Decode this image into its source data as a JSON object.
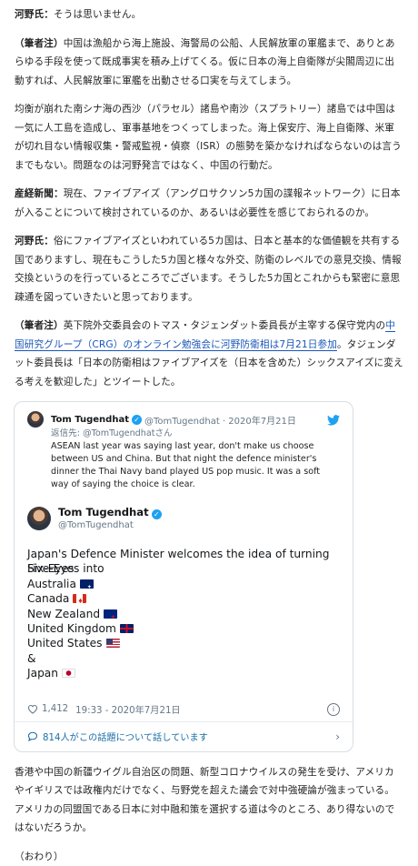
{
  "paragraphs": {
    "p1_speaker": "河野氏：",
    "p1_text": "そうは思いません。",
    "p2_speaker": "（筆者注）",
    "p2_text": "中国は漁船から海上施設、海警局の公船、人民解放軍の軍艦まで、ありとあらゆる手段を使って既成事実を積み上げてくる。仮に日本の海上自衛隊が尖閣周辺に出動すれば、人民解放軍に軍艦を出動させる口実を与えてしまう。",
    "p3_text": "均衡が崩れた南シナ海の西沙（パラセル）諸島や南沙（スプラトリー）諸島では中国は一気に人工島を造成し、軍事基地をつくってしまった。海上保安庁、海上自衛隊、米軍が切れ目ない情報収集・警戒監視・偵察（ISR）の態勢を築かなければならないのは言うまでもない。問題なのは河野発言ではなく、中国の行動だ。",
    "p4_speaker": "産経新聞：",
    "p4_text": "現在、ファイブアイズ（アングロサクソン5カ国の諜報ネットワーク）に日本が入ることについて検討されているのか、あるいは必要性を感じておられるのか。",
    "p5_speaker": "河野氏：",
    "p5_text": "俗にファイブアイズといわれている5カ国は、日本と基本的な価値観を共有する国でありますし、現在もこうした5カ国と様々な外交、防衛のレベルでの意見交換、情報交換というのを行っているところでございます。そうした5カ国とこれからも緊密に意思疎通を図っていきたいと思っております。",
    "p6_speaker": "（筆者注）",
    "p6_before": "英下院外交委員会のトマス・タジェンダット委員長が主宰する保守党内の",
    "p6_link": "中国研究グループ（CRG）のオンライン勉強会に河野防衛相は7月21日参加",
    "p6_after": "。タジェンダット委員長は「日本の防衛相はファイブアイズを（日本を含めた）シックスアイズに変える考えを歓迎した」とツイートした。",
    "p7_text": "香港や中国の新疆ウイグル自治区の問題、新型コロナウイルスの発生を受け、アメリカやイギリスでは政権内だけでなく、与野党を超えた議会で対中強硬論が強まっている。アメリカの同盟国である日本に対中融和策を選択する道は今のところ、あり得ないのではないだろうか。",
    "p8_text": "（おわり）"
  },
  "tweet": {
    "quoted": {
      "name": "Tom Tugendhat",
      "handle_date": "@TomTugendhat · 2020年7月21日",
      "reply_to": "返信先: @TomTugendhatさん",
      "text": "ASEAN last year was saying last year, don't make us choose between US and China. But that night the defence minister's dinner the Thai Navy band played US pop music. It was a soft way of saying the choice is clear."
    },
    "author_name": "Tom Tugendhat",
    "author_handle": "@TomTugendhat",
    "lines": [
      "Japan's Defence Minister welcomes the idea of turning Five-Eyes into",
      "Six-Eyes",
      "Australia",
      "Canada",
      "New Zealand",
      "United Kingdom",
      "United States",
      "&",
      "Japan"
    ],
    "likes": "1,412",
    "timestamp": "19:33 - 2020年7月21日",
    "talking": "814人がこの話題について話しています",
    "colors": {
      "link": "#1a56b8",
      "twitter_blue": "#1da1f2",
      "muted": "#657786"
    }
  }
}
